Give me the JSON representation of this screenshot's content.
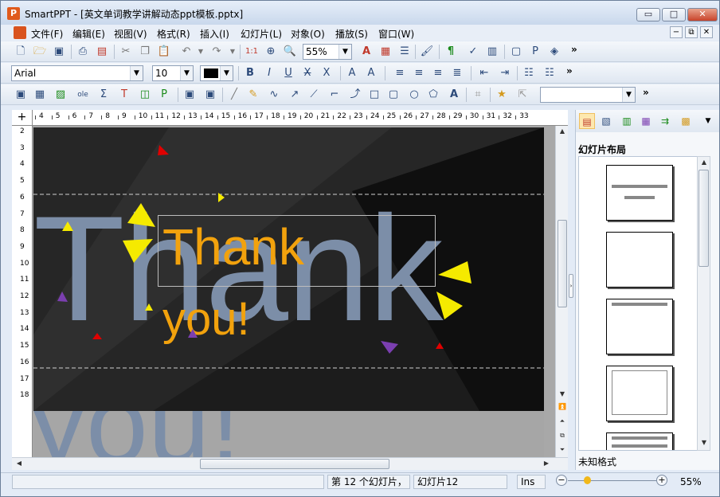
{
  "window": {
    "title": "SmartPPT - [英文单词教学讲解动态ppt模板.pptx]",
    "app_icon": "P"
  },
  "window_controls": {
    "minimize": "▭",
    "maximize": "□",
    "close": "✕"
  },
  "menu": {
    "items": [
      "文件(F)",
      "编辑(E)",
      "视图(V)",
      "格式(R)",
      "插入(I)",
      "幻灯片(L)",
      "对象(O)",
      "播放(S)",
      "窗口(W)"
    ],
    "mdi_controls": [
      "−",
      "⧉",
      "✕"
    ]
  },
  "toolbar1": {
    "zoom_value": "55%",
    "overflow": "»"
  },
  "toolbar2": {
    "font_name": "Arial",
    "font_size": "10",
    "overflow": "»"
  },
  "toolbar3": {
    "style_value": "",
    "overflow": "»"
  },
  "ruler": {
    "h_numbers": [
      "4",
      "5",
      "6",
      "7",
      "8",
      "9",
      "10",
      "11",
      "12",
      "13",
      "14",
      "15",
      "16",
      "17",
      "18",
      "19",
      "20",
      "21",
      "22",
      "23",
      "24",
      "25",
      "26",
      "27",
      "28",
      "29",
      "30",
      "31",
      "32",
      "33"
    ],
    "v_numbers": [
      "2",
      "3",
      "4",
      "5",
      "6",
      "7",
      "8",
      "9",
      "10",
      "11",
      "12",
      "13",
      "14",
      "15",
      "16",
      "17",
      "18"
    ]
  },
  "slide": {
    "ghost_text_1": "Thank",
    "ghost_text_2": "you!",
    "title_line_1": "Thank",
    "title_line_2": "you!"
  },
  "panel": {
    "title": "幻灯片布局",
    "status": "未知格式"
  },
  "statusbar": {
    "slide_info": "第 12 个幻灯片，",
    "slide_name": "幻灯片12",
    "mode": "Ins",
    "zoom_value": "55%"
  },
  "colors": {
    "slide_bg": "#1c1c1c",
    "ghost_text": "#7c8ea8",
    "title_text": "#f2a20d",
    "triangle_yellow": "#f5ea00",
    "triangle_red": "#e00000",
    "triangle_purple": "#7b3fb0"
  }
}
